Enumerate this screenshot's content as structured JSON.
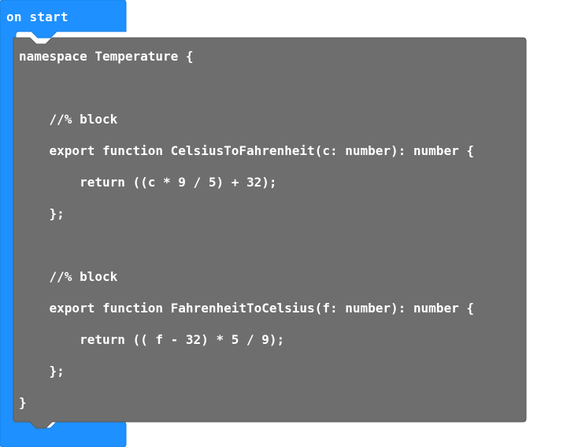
{
  "colors": {
    "hat_block": "#1e90ff",
    "hat_block_border": "#1a7fe0",
    "code_block": "#6e6e6e",
    "code_block_border": "#5a5a5a",
    "text": "#ffffff",
    "background": "#ffffff"
  },
  "hat_block": {
    "label": "on start"
  },
  "code_block": {
    "lines": [
      "namespace Temperature {",
      "",
      "",
      "    //% block",
      "",
      "    export function CelsiusToFahrenheit(c: number): number {",
      "",
      "        return ((c * 9 / 5) + 32);",
      "",
      "    };",
      "",
      "",
      "    //% block",
      "",
      "    export function FahrenheitToCelsius(f: number): number {",
      "",
      "        return (( f - 32) * 5 / 9);",
      "",
      "    };",
      "",
      "}"
    ]
  }
}
